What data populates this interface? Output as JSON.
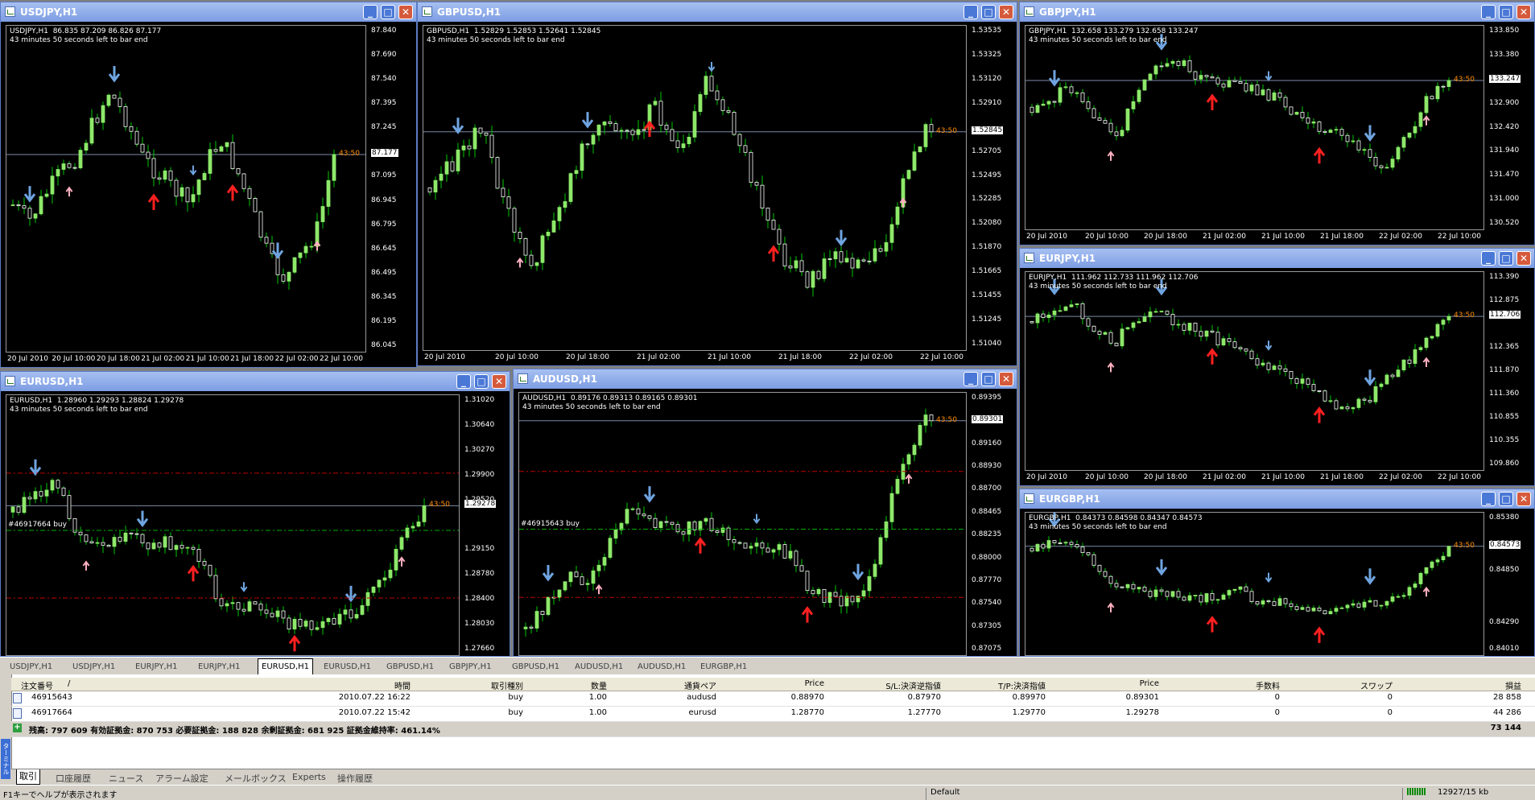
{
  "colors": {
    "candle_up": "#8ee86a",
    "candle_down": "#ffffff",
    "wick": "#00c800",
    "bid_line": "#7b8aa8",
    "countdown": "#ff8c00",
    "arrow_blue": "#6fa4e0",
    "arrow_red": "#ff2020",
    "arrow_pink": "#ffb0c0",
    "order_line": "#00b000",
    "level_line": "#c00000",
    "title_bar": "#7d9de3"
  },
  "window_controls": {
    "minimize": "_",
    "maximize": "□",
    "close": "✕"
  },
  "chart_info_line": "43 minutes 50 seconds left to bar end",
  "charts": [
    {
      "title": "USDJPY,H1",
      "header": "USDJPY,H1  86.835 87.209 86.826 87.177",
      "y_ticks": [
        "87.840",
        "87.690",
        "87.540",
        "87.395",
        "87.245",
        "87.177",
        "87.095",
        "86.945",
        "86.795",
        "86.645",
        "86.495",
        "86.345",
        "86.195",
        "86.045"
      ],
      "current_price": "87.177",
      "countdown": "43:50",
      "x_ticks": [
        "20 Jul 2010",
        "20 Jul 10:00",
        "20 Jul 18:00",
        "21 Jul 02:00",
        "21 Jul 10:00",
        "21 Jul 18:00",
        "22 Jul 02:00",
        "22 Jul 10:00"
      ]
    },
    {
      "title": "GBPUSD,H1",
      "header": "GBPUSD,H1  1.52829 1.52853 1.52641 1.52845",
      "y_ticks": [
        "1.53535",
        "1.53325",
        "1.53120",
        "1.52910",
        "1.52845",
        "1.52705",
        "1.52495",
        "1.52285",
        "1.52080",
        "1.51870",
        "1.51665",
        "1.51455",
        "1.51245",
        "1.51040"
      ],
      "current_price": "1.52845",
      "countdown": "43:50",
      "x_ticks": [
        "20 Jul 2010",
        "20 Jul 10:00",
        "20 Jul 18:00",
        "21 Jul 02:00",
        "21 Jul 10:00",
        "21 Jul 18:00",
        "22 Jul 02:00",
        "22 Jul 10:00"
      ]
    },
    {
      "title": "GBPJPY,H1",
      "header": "GBPJPY,H1  132.658 133.279 132.658 133.247",
      "y_ticks": [
        "133.850",
        "133.380",
        "133.247",
        "132.900",
        "132.420",
        "131.940",
        "131.470",
        "131.000",
        "130.520"
      ],
      "current_price": "133.247",
      "countdown": "43:50",
      "x_ticks": [
        "20 Jul 2010",
        "20 Jul 10:00",
        "20 Jul 18:00",
        "21 Jul 02:00",
        "21 Jul 10:00",
        "21 Jul 18:00",
        "22 Jul 02:00",
        "22 Jul 10:00"
      ]
    },
    {
      "title": "EURUSD,H1",
      "header": "EURUSD,H1  1.28960 1.29293 1.28824 1.29278",
      "y_ticks": [
        "1.31020",
        "1.30640",
        "1.30270",
        "1.29900",
        "1.29520",
        "1.29278",
        "1.29150",
        "1.28780",
        "1.28400",
        "1.28030",
        "1.27660"
      ],
      "current_price": "1.29278",
      "countdown": "43:50",
      "order_label": "#46917664 buy",
      "x_ticks": []
    },
    {
      "title": "AUDUSD,H1",
      "header": "AUDUSD,H1  0.89176 0.89313 0.89165 0.89301",
      "y_ticks": [
        "0.89395",
        "0.89301",
        "0.89160",
        "0.88930",
        "0.88700",
        "0.88465",
        "0.88235",
        "0.88000",
        "0.87770",
        "0.87540",
        "0.87305",
        "0.87075"
      ],
      "current_price": "0.89301",
      "countdown": "43:50",
      "order_label": "#46915643 buy",
      "x_ticks": []
    },
    {
      "title": "EURJPY,H1",
      "header": "EURJPY,H1  111.962 112.733 111.962 112.706",
      "y_ticks": [
        "113.390",
        "112.875",
        "112.706",
        "112.365",
        "111.870",
        "111.360",
        "110.855",
        "110.355",
        "109.860"
      ],
      "current_price": "112.706",
      "countdown": "43:50",
      "x_ticks": [
        "20 Jul 2010",
        "20 Jul 10:00",
        "20 Jul 18:00",
        "21 Jul 02:00",
        "21 Jul 10:00",
        "21 Jul 18:00",
        "22 Jul 02:00",
        "22 Jul 10:00"
      ]
    },
    {
      "title": "EURGBP,H1",
      "header": "EURGBP,H1  0.84373 0.84598 0.84347 0.84573",
      "y_ticks": [
        "0.85380",
        "0.85125",
        "0.84850",
        "0.84573",
        "0.84290",
        "0.84010"
      ],
      "current_price": "0.84573",
      "countdown": "43:50",
      "x_ticks": []
    }
  ],
  "chart_tabs": [
    "USDJPY,H1",
    "USDJPY,H1",
    "EURJPY,H1",
    "EURJPY,H1",
    "EURUSD,H1",
    "EURUSD,H1",
    "GBPUSD,H1",
    "GBPJPY,H1",
    "GBPUSD,H1",
    "AUDUSD,H1",
    "AUDUSD,H1",
    "EURGBP,H1"
  ],
  "active_chart_tab": 4,
  "terminal": {
    "side_label": "ターミナル",
    "columns": [
      "注文番号",
      "",
      "時間",
      "取引種別",
      "数量",
      "通貨ペア",
      "Price",
      "S/L:決済逆指値",
      "T/P:決済指値",
      "Price",
      "手数料",
      "スワップ",
      "損益"
    ],
    "rows": [
      [
        "46915643",
        "",
        "2010.07.22 16:22",
        "buy",
        "1.00",
        "audusd",
        "0.88970",
        "0.87970",
        "0.89970",
        "0.89301",
        "0",
        "0",
        "28 858"
      ],
      [
        "46917664",
        "",
        "2010.07.22 15:42",
        "buy",
        "1.00",
        "eurusd",
        "1.28770",
        "1.27770",
        "1.29770",
        "1.29278",
        "0",
        "0",
        "44 286"
      ]
    ],
    "balance_line": "残高: 797 609   有効証拠金: 870 753   必要証拠金: 188 828   余剰証拠金: 681 925   証拠金維持率: 461.14%",
    "balance_total": "73 144",
    "tabs": [
      "取引",
      "口座履歴",
      "ニュース",
      "アラーム設定",
      "メールボックス",
      "Experts",
      "操作履歴"
    ],
    "active_tab": 0
  },
  "status_bar": {
    "help": "F1キーでヘルプが表示されます",
    "profile": "Default",
    "traffic": "12927/15 kb"
  }
}
